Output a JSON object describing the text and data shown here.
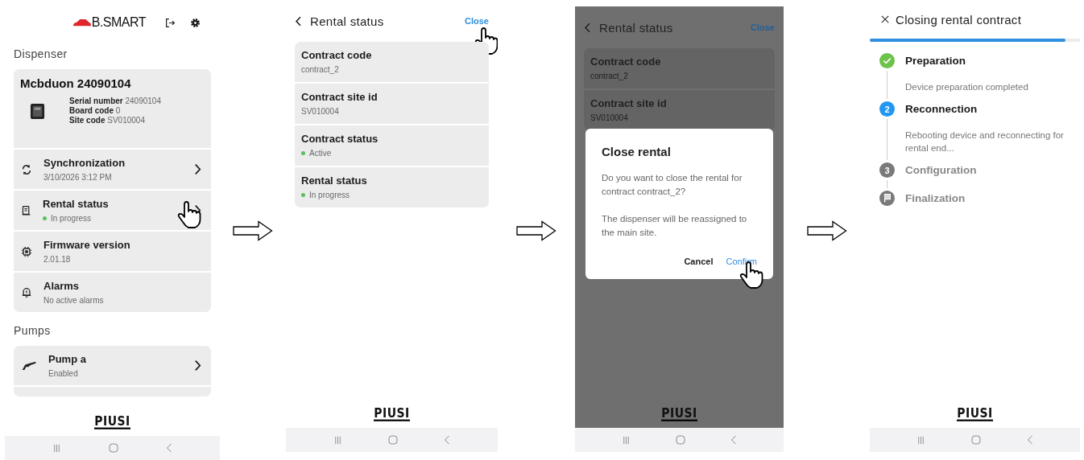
{
  "screens": [
    {
      "kind": "home",
      "logo": "B.SMART",
      "section": "Dispenser",
      "device": {
        "name": "Mcbduon 24090104",
        "fields": [
          "**Serial number** 24090104",
          "**Board code** 0",
          "**Site code** SV010004"
        ]
      },
      "items": [
        {
          "kind": "sync",
          "title": "Synchronization",
          "subtitle": "3/10/2026 3:12 PM",
          "chevron": true,
          "tapped": false
        },
        {
          "kind": "rental",
          "title": "Rental status",
          "subtitle": "In progress",
          "color": "#5cbf5c",
          "chevron": true,
          "tapped": true
        },
        {
          "kind": "firmware",
          "title": "Firmware version",
          "subtitle": "2.01.18",
          "chevron": false,
          "tapped": false
        },
        {
          "kind": "alarm",
          "title": "Alarms",
          "subtitle": "No active alarms",
          "chevron": false,
          "tapped": false
        }
      ],
      "section2": "Pumps",
      "pumps": [
        {
          "kind": "pump",
          "title": "Pump a",
          "subtitle": "Enabled",
          "chevron": true,
          "tapped": false
        }
      ],
      "footer_logo": "PIUSI"
    },
    {
      "kind": "detail",
      "title": "Rental status",
      "action": "Close",
      "action_tapped": true,
      "dimmed": false,
      "fields": [
        {
          "label": "Contract code",
          "value": "contract_2"
        },
        {
          "label": "Contract site id",
          "value": "SV010004"
        },
        {
          "label": "Contract status",
          "value": "Active",
          "color": "#5cbf5c"
        },
        {
          "label": "Rental status",
          "value": "In progress",
          "color": "#5cbf5c"
        }
      ],
      "footer_logo": "PIUSI"
    },
    {
      "kind": "detail",
      "title": "Rental status",
      "action": "Close",
      "action_tapped": false,
      "dimmed": true,
      "fields": [
        {
          "label": "Contract code",
          "value": "contract_2"
        },
        {
          "label": "Contract site id",
          "value": "SV010004"
        }
      ],
      "dialog": {
        "title": "Close rental",
        "paragraphs": [
          "Do you want to close the rental for contract contract_2?",
          "The dispenser will be reassigned to the main site."
        ],
        "buttons": [
          {
            "kind": "cancel",
            "label": "Cancel",
            "tapped": false
          },
          {
            "kind": "confirm",
            "label": "Confirm",
            "tapped": true
          }
        ]
      },
      "footer_logo": "PIUSI"
    },
    {
      "kind": "progress",
      "title": "Closing rental contract",
      "level": 0.93,
      "steps": [
        {
          "kind": "check",
          "completed": true,
          "current": false,
          "title": "Preparation",
          "description": "Device preparation completed"
        },
        {
          "kind": "number",
          "completed": false,
          "current": true,
          "number": "2",
          "title": "Reconnection",
          "description": "Rebooting device and reconnecting for rental end..."
        },
        {
          "kind": "number",
          "completed": false,
          "current": false,
          "number": "3",
          "title": "Configuration"
        },
        {
          "kind": "flag",
          "completed": false,
          "current": false,
          "title": "Finalization"
        }
      ],
      "footer_logo": "PIUSI"
    }
  ]
}
